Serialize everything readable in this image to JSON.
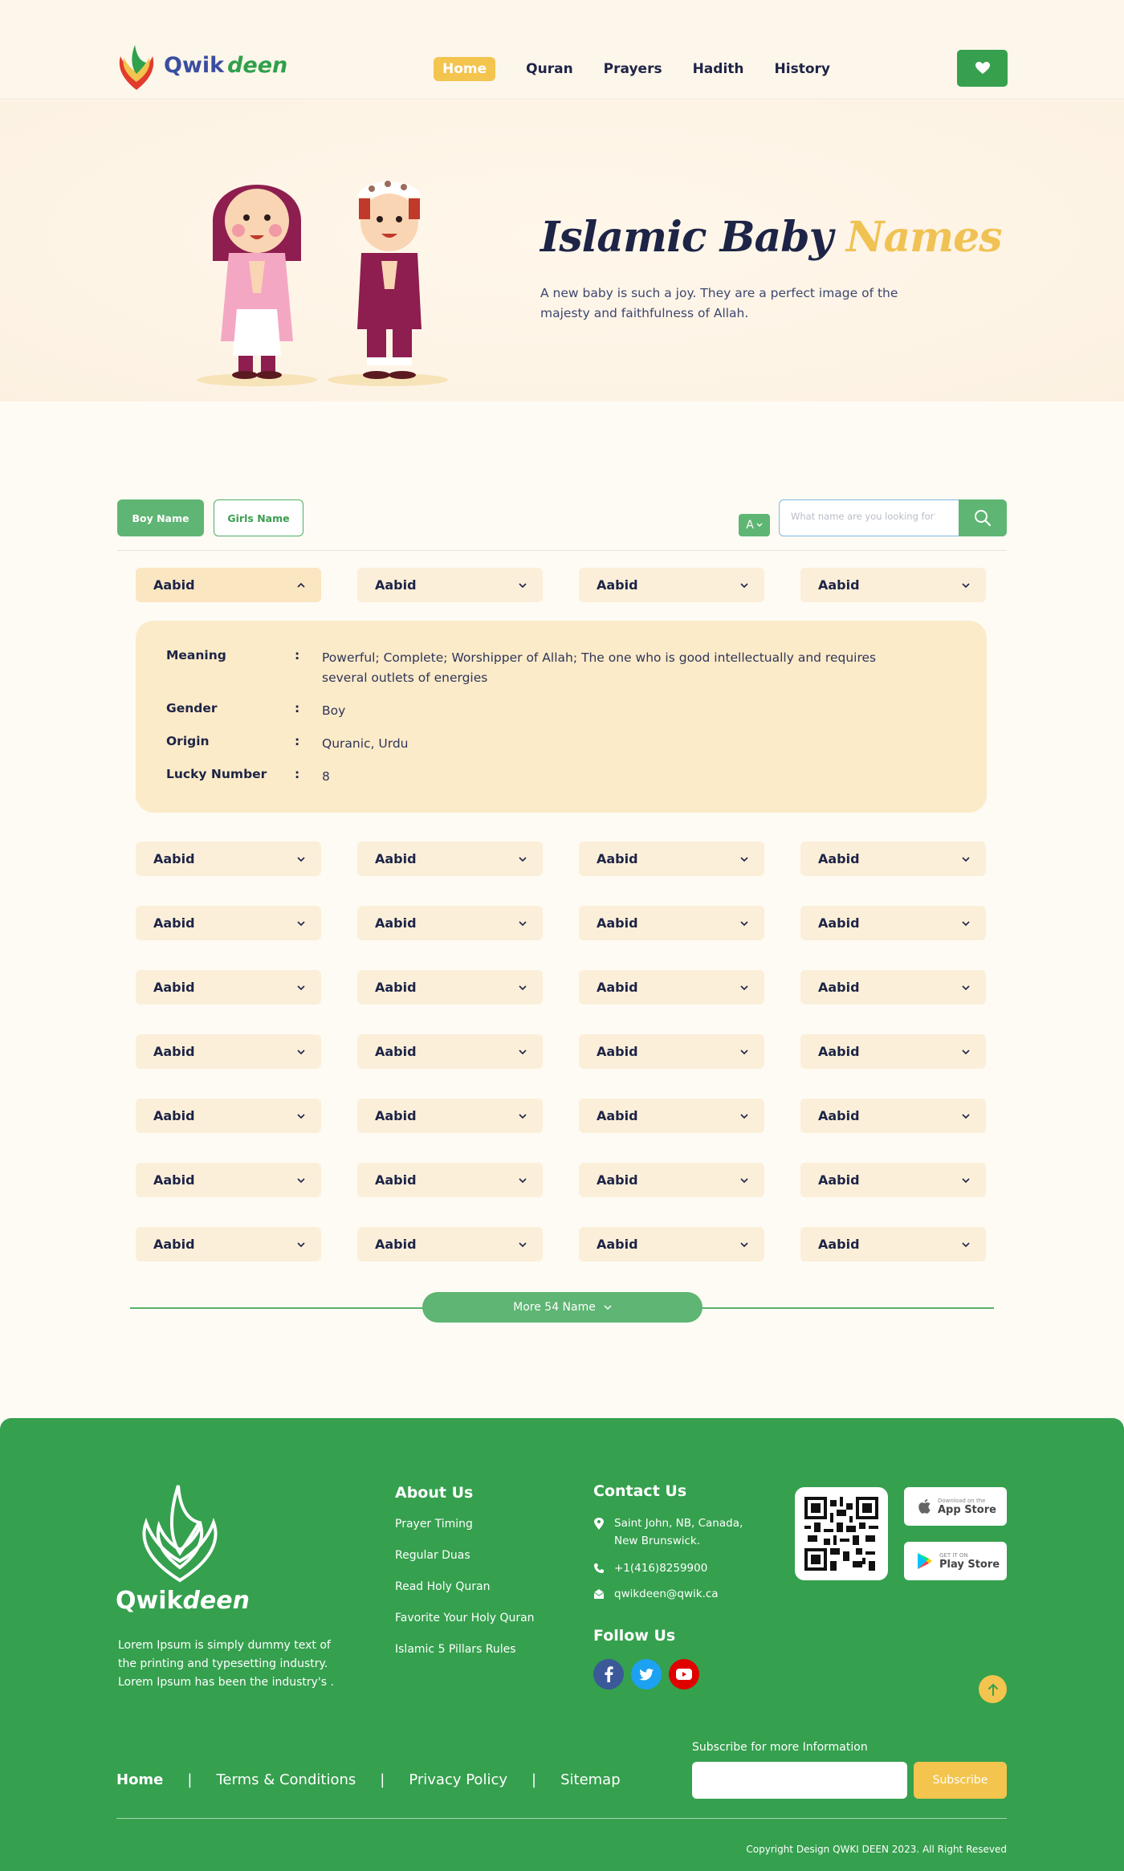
{
  "header": {
    "logo_part1": "Qwik",
    "logo_part2": "deen",
    "nav": [
      "Home",
      "Quran",
      "Prayers",
      "Hadith",
      "History"
    ],
    "favorites_icon": "heart-icon"
  },
  "hero": {
    "title_part1": "Islamic Baby",
    "title_part2": "Names",
    "description": "A new baby is such a joy. They are a perfect image of the majesty and faithfulness of Allah."
  },
  "filters": {
    "boy_tab": "Boy Name",
    "girl_tab": "Girls Name",
    "letter": "A",
    "search_placeholder": "What name are you looking for?"
  },
  "names": {
    "row1": [
      "Aabid",
      "Aabid",
      "Aabid",
      "Aabid"
    ],
    "grid": [
      [
        "Aabid",
        "Aabid",
        "Aabid",
        "Aabid"
      ],
      [
        "Aabid",
        "Aabid",
        "Aabid",
        "Aabid"
      ],
      [
        "Aabid",
        "Aabid",
        "Aabid",
        "Aabid"
      ],
      [
        "Aabid",
        "Aabid",
        "Aabid",
        "Aabid"
      ],
      [
        "Aabid",
        "Aabid",
        "Aabid",
        "Aabid"
      ],
      [
        "Aabid",
        "Aabid",
        "Aabid",
        "Aabid"
      ],
      [
        "Aabid",
        "Aabid",
        "Aabid",
        "Aabid"
      ]
    ]
  },
  "detail": {
    "meaning_label": "Meaning",
    "meaning": "Powerful; Complete; Worshipper of Allah; The one who is good intellectually and requires several outlets of energies",
    "gender_label": "Gender",
    "gender": "Boy",
    "origin_label": "Origin",
    "origin": "Quranic, Urdu",
    "lucky_label": "Lucky Number",
    "lucky": "8",
    "colon": ":"
  },
  "more_button": "More 54 Name",
  "footer": {
    "logo_part1": "Qwik",
    "logo_part2": "deen",
    "description": "Lorem Ipsum is simply dummy text of the printing and typesetting industry.  Lorem Ipsum has been the industry's .",
    "about_title": "About Us",
    "about_links": [
      "Prayer Timing",
      "Regular Duas",
      "Read Holy Quran",
      "Favorite Your Holy Quran",
      "Islamic 5 Pillars Rules"
    ],
    "contact_title": "Contact Us",
    "address": "Saint John, NB, Canada, New Brunswick.",
    "phone": "+1(416)8259900",
    "email": "qwikdeen@qwik.ca",
    "follow_title": "Follow Us",
    "app_store_small": "Download on the",
    "app_store_big": "App Store",
    "play_store_small": "GET IT ON",
    "play_store_big": "Play Store",
    "subscribe_label": "Subscribe for more Information",
    "subscribe_button": "Subscribe",
    "nav": [
      "Home",
      "Terms & Conditions",
      "Privacy Policy",
      "Sitemap"
    ],
    "nav_separator": "|",
    "copyright": "Copyright Design QWKI DEEN 2023.  All Right Reseved"
  },
  "colors": {
    "green": "#35a04e",
    "light_green": "#5fb573",
    "yellow": "#f3c44e",
    "navy": "#1d2446",
    "cream": "#fbefd9"
  }
}
